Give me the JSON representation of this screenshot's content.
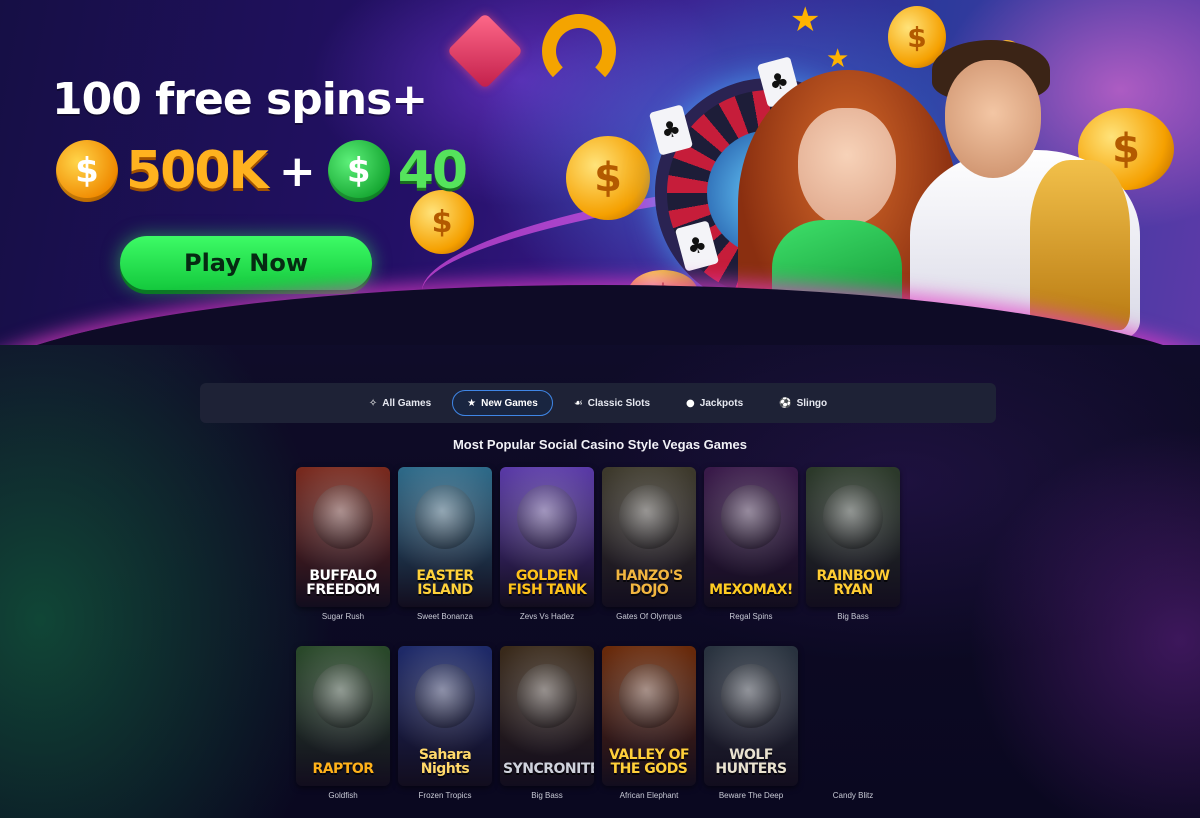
{
  "hero": {
    "title": "100 free spins+",
    "coin_symbol": "$",
    "gold_amount": "500K",
    "plus": "+",
    "green_amount": "40",
    "play_label": "Play Now",
    "slides": 3,
    "active_slide": 2
  },
  "tabs": [
    {
      "label": "All Games",
      "icon": "grid-sparkle-icon",
      "glyph": "✧",
      "active": false
    },
    {
      "label": "New Games",
      "icon": "star-icon",
      "glyph": "★",
      "active": true
    },
    {
      "label": "Classic Slots",
      "icon": "cherries-icon",
      "glyph": "☙",
      "active": false
    },
    {
      "label": "Jackpots",
      "icon": "money-bag-icon",
      "glyph": "●",
      "active": false
    },
    {
      "label": "Slingo",
      "icon": "ball-icon",
      "glyph": "⚽",
      "active": false
    }
  ],
  "section_title": "Most Popular Social Casino Style Vegas Games",
  "games_row1": [
    {
      "logo": "BUFFALO FREEDOM",
      "name": "Sugar Rush",
      "bg": "#7a2a1e",
      "logo_color": "#ffffff"
    },
    {
      "logo": "EASTER ISLAND",
      "name": "Sweet Bonanza",
      "bg": "#2e6b8a",
      "logo_color": "#ffd23a"
    },
    {
      "logo": "GOLDEN FISH TANK",
      "name": "Zevs Vs Hadez",
      "bg": "#5a3aa8",
      "logo_color": "#ffc21a"
    },
    {
      "logo": "HANZO'S DOJO",
      "name": "Gates Of Olympus",
      "bg": "#3e3a2c",
      "logo_color": "#f2b640"
    },
    {
      "logo": "MEXOMAX!",
      "name": "Regal Spins",
      "bg": "#3a1a4a",
      "logo_color": "#ffcc22"
    },
    {
      "logo": "RAINBOW RYAN",
      "name": "Big Bass",
      "bg": "#2c3a2a",
      "logo_color": "#ffcc33"
    }
  ],
  "games_row2": [
    {
      "logo": "RAPTOR",
      "name": "Goldfish",
      "bg": "#2a4a2a",
      "logo_color": "#ffb21a"
    },
    {
      "logo": "Sahara Nights",
      "name": "Frozen Tropics",
      "bg": "#1e2a6a",
      "logo_color": "#ffd86a"
    },
    {
      "logo": "SYNCRONITE",
      "name": "Big Bass",
      "bg": "#3a2a1a",
      "logo_color": "#cfd2dc"
    },
    {
      "logo": "VALLEY OF THE GODS",
      "name": "African Elephant",
      "bg": "#6a2a0a",
      "logo_color": "#ffcf3a"
    },
    {
      "logo": "WOLF HUNTERS",
      "name": "Beware The Deep",
      "bg": "#2a3440",
      "logo_color": "#e9e2d0"
    },
    {
      "logo": "",
      "name": "Candy Blitz",
      "bg": "transparent",
      "logo_color": "#ffffff"
    }
  ]
}
